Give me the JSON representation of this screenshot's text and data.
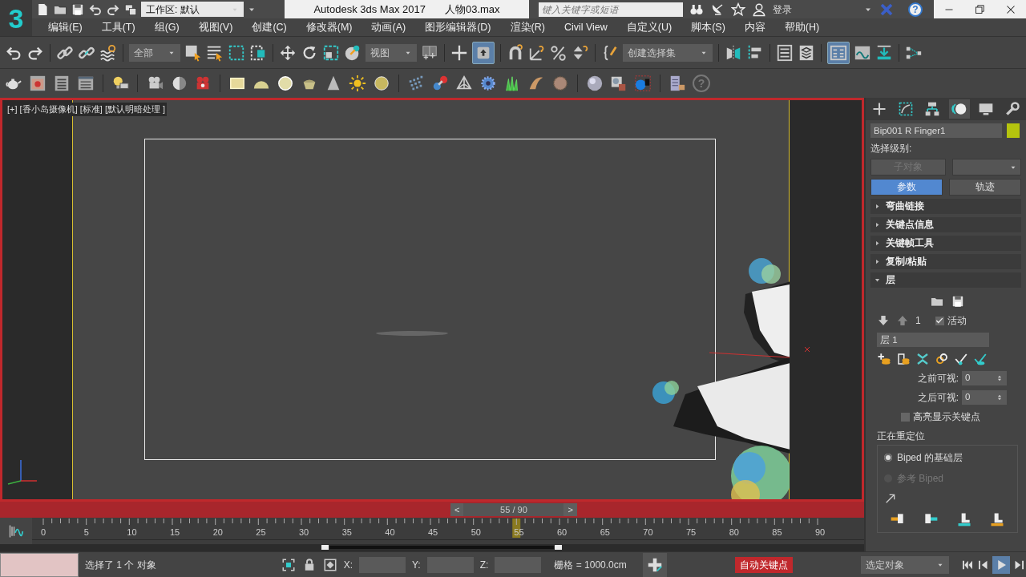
{
  "app": {
    "logo": "3",
    "workspace": "工作区: 默认",
    "title": "Autodesk 3ds Max 2017",
    "file": "人物03.max",
    "search_placeholder": "键入关键字或短语",
    "login": "登录",
    "help": "?"
  },
  "menu": [
    "编辑(E)",
    "工具(T)",
    "组(G)",
    "视图(V)",
    "创建(C)",
    "修改器(M)",
    "动画(A)",
    "图形编辑器(D)",
    "渲染(R)",
    "Civil View",
    "自定义(U)",
    "脚本(S)",
    "内容",
    "帮助(H)"
  ],
  "main_toolbar": {
    "selection_filter": "全部",
    "reference_coord": "视图",
    "named_selection": "创建选择集",
    "manipulate_on": true,
    "scene_explorer_on": true
  },
  "render_toolbar": {
    "help": "?"
  },
  "viewport": {
    "label": "[+] [香小岛摄像机] [标准] [默认明暗处理 ]",
    "active": true,
    "safe_frame": true
  },
  "command_panel": {
    "tabs": [
      {
        "selected": false
      },
      {
        "selected": false
      },
      {
        "selected": false
      },
      {
        "selected": true
      },
      {
        "selected": false
      },
      {
        "selected": false
      }
    ],
    "object_name": "Bip001 R Finger1",
    "selection_level_label": "选择级别:",
    "sub_object": {
      "label": "子对象",
      "disabled": true
    },
    "mode_buttons": [
      {
        "label": "参数",
        "selected": true
      },
      {
        "label": "轨迹",
        "selected": false
      }
    ],
    "rollouts": [
      {
        "title": "弯曲链接",
        "expanded": false
      },
      {
        "title": "关键点信息",
        "expanded": false
      },
      {
        "title": "关键帧工具",
        "expanded": false
      },
      {
        "title": "复制/粘贴",
        "expanded": false
      },
      {
        "title": "层",
        "expanded": true
      }
    ],
    "layers": {
      "count": "1",
      "active_label": "活动",
      "active": true,
      "layer_name": "层 1",
      "before_label": "之前可视:",
      "before_value": "0",
      "after_label": "之后可视:",
      "after_value": "0",
      "highlight_label": "高亮显示关键点",
      "highlight": false,
      "retarget_title": "正在重定位",
      "retarget_options": [
        {
          "label": "Biped 的基础层",
          "selected": true,
          "disabled": false
        },
        {
          "label": "参考 Biped",
          "selected": false,
          "disabled": true
        }
      ]
    }
  },
  "timeline": {
    "prev": "<",
    "frame": "55 / 90",
    "next": ">",
    "level": 0.611,
    "ruler_labels": [
      "0",
      "5",
      "10",
      "15",
      "20",
      "25",
      "30",
      "35",
      "40",
      "45",
      "50",
      "55",
      "60",
      "65",
      "70",
      "75",
      "80",
      "85",
      "90"
    ]
  },
  "status": {
    "selection": "选择了 1 个 对象",
    "x_label": "X:",
    "y_label": "Y:",
    "z_label": "Z:",
    "grid": "栅格 = 1000.0cm",
    "auto_key_label": "自动关键点",
    "auto_key": true,
    "key_filter": "选定对象",
    "play_selected": true
  }
}
